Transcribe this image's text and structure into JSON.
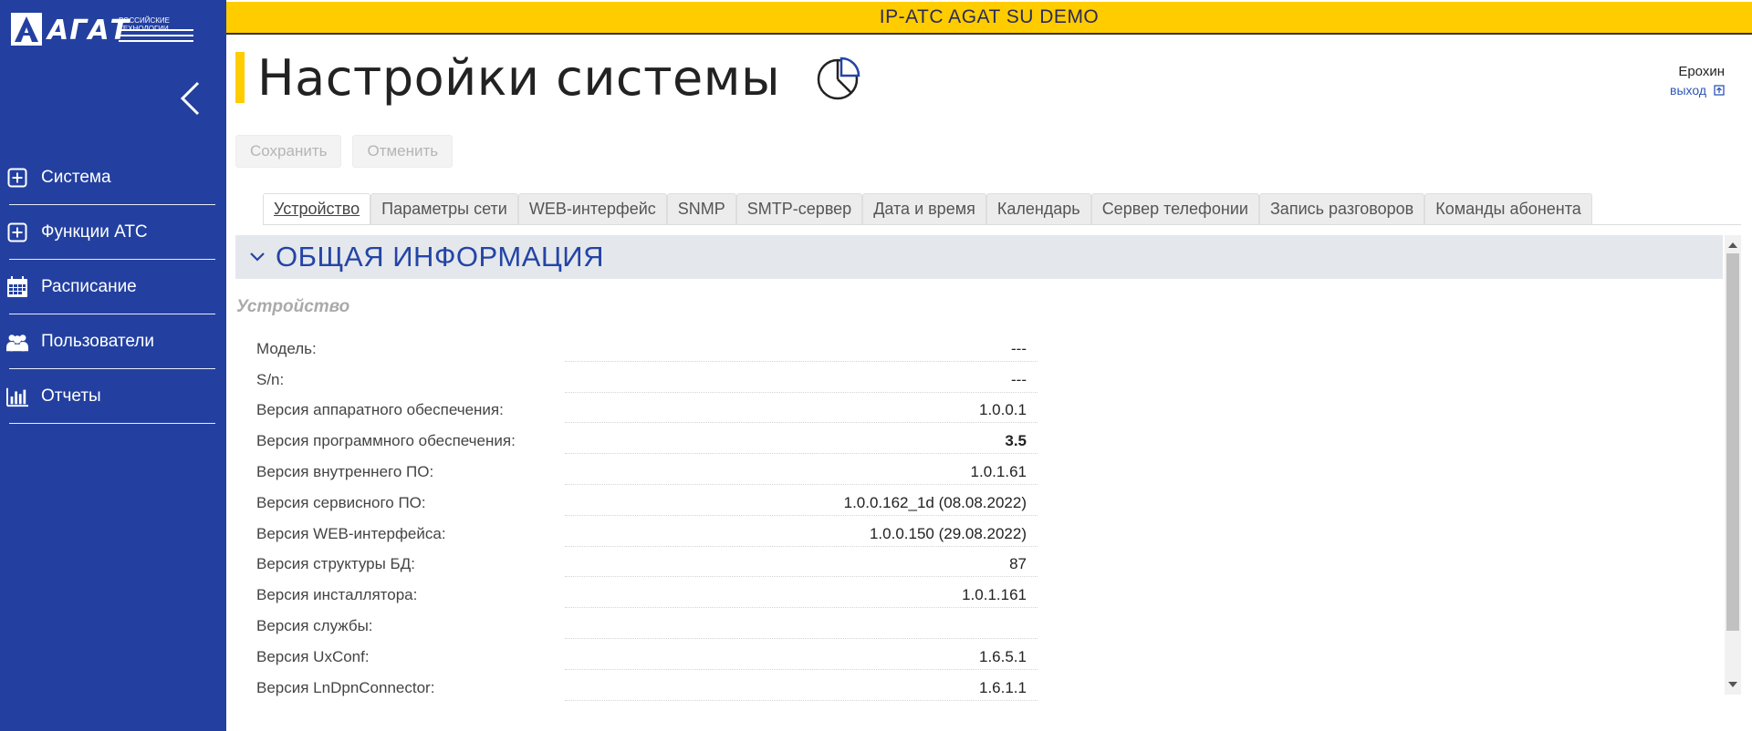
{
  "app": {
    "brand": "АГАТ",
    "brand_sub": "РОССИЙСКИЕ ТЕХНОЛОГИИ",
    "banner": "IP-ATC AGAT SU DEMO"
  },
  "sidebar": {
    "items": [
      {
        "label": "Система",
        "icon": "plus-box-icon"
      },
      {
        "label": "Функции АТС",
        "icon": "plus-box-icon"
      },
      {
        "label": "Расписание",
        "icon": "calendar-icon"
      },
      {
        "label": "Пользователи",
        "icon": "users-icon"
      },
      {
        "label": "Отчеты",
        "icon": "bar-chart-icon"
      }
    ]
  },
  "header": {
    "title": "Настройки системы",
    "user_name": "Ерохин",
    "logout_label": "выход"
  },
  "toolbar": {
    "save_label": "Сохранить",
    "cancel_label": "Отменить"
  },
  "tabs": [
    {
      "label": "Устройство",
      "active": true
    },
    {
      "label": "Параметры сети"
    },
    {
      "label": "WEB-интерфейс"
    },
    {
      "label": "SNMP"
    },
    {
      "label": "SMTP-сервер"
    },
    {
      "label": "Дата и время"
    },
    {
      "label": "Календарь"
    },
    {
      "label": "Сервер телефонии"
    },
    {
      "label": "Запись разговоров"
    },
    {
      "label": "Команды абонента"
    }
  ],
  "section": {
    "title": "ОБЩАЯ ИНФОРМАЦИЯ",
    "subtitle": "Устройство"
  },
  "device_info": [
    {
      "label": "Модель:",
      "value": "---"
    },
    {
      "label": "S/n:",
      "value": "---"
    },
    {
      "label": "Версия аппаратного обеспечения:",
      "value": "1.0.0.1"
    },
    {
      "label": "Версия программного обеспечения:",
      "value": "3.5",
      "bold": true
    },
    {
      "label": "Версия внутреннего ПО:",
      "value": "1.0.1.61"
    },
    {
      "label": "Версия сервисного ПО:",
      "value": "1.0.0.162_1d (08.08.2022)"
    },
    {
      "label": "Версия WEB-интерфейса:",
      "value": "1.0.0.150 (29.08.2022)"
    },
    {
      "label": "Версия структуры БД:",
      "value": "87"
    },
    {
      "label": "Версия инсталлятора:",
      "value": "1.0.1.161"
    },
    {
      "label": "Версия службы:",
      "value": ""
    },
    {
      "label": "Версия UxConf:",
      "value": "1.6.5.1"
    },
    {
      "label": "Версия LnDpnConnector:",
      "value": "1.6.1.1"
    }
  ],
  "colors": {
    "sidebar": "#2340a0",
    "banner": "#ffcc00",
    "accent": "#2444a6"
  }
}
